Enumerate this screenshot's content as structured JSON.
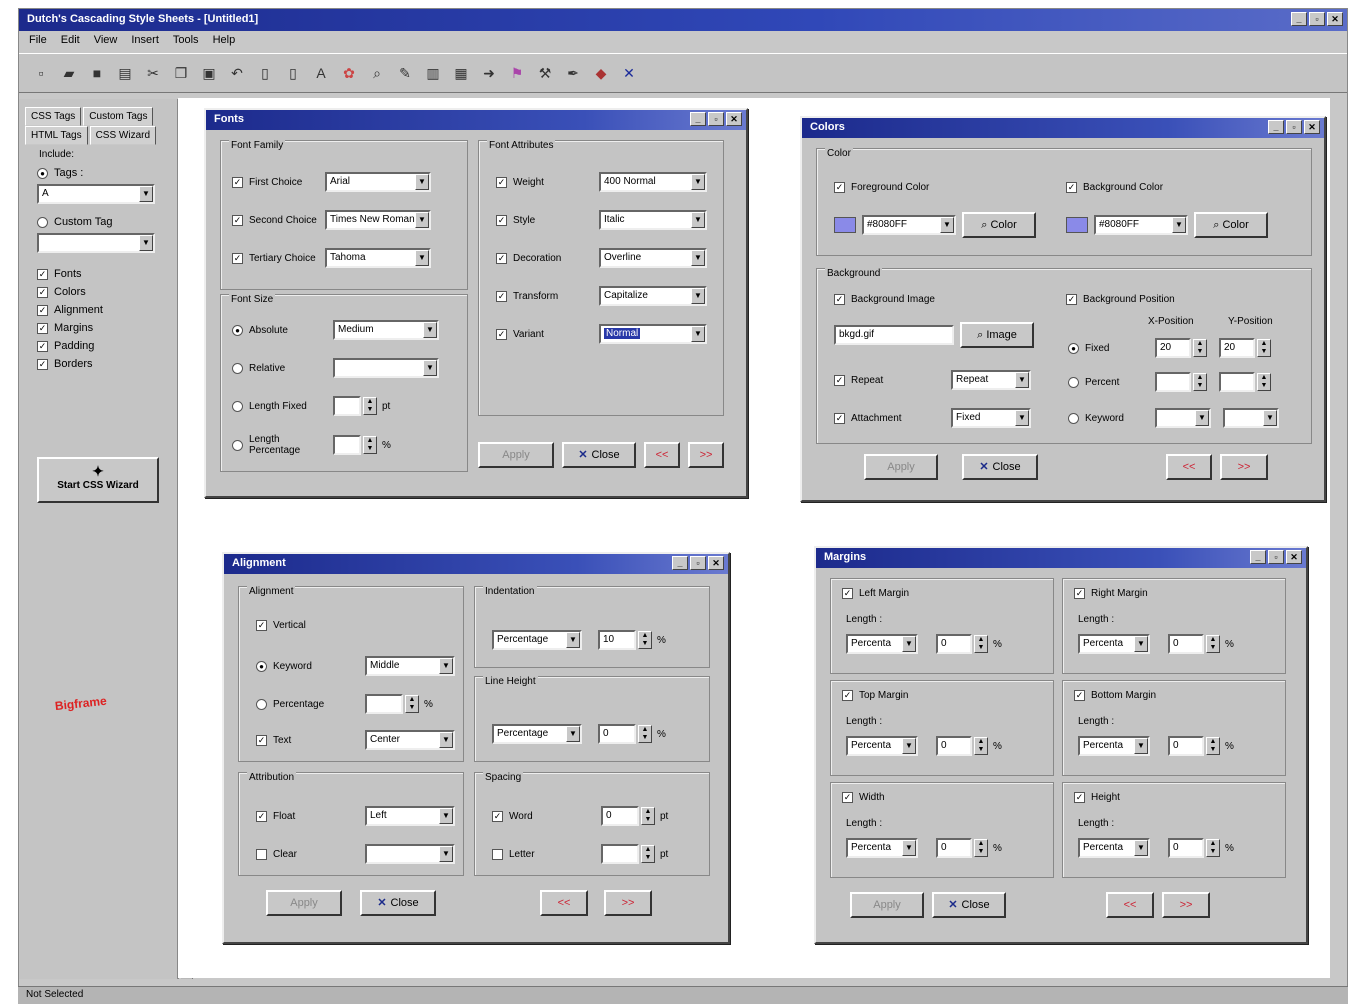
{
  "window": {
    "title": "Dutch's Cascading Style Sheets - [Untitled1]",
    "buttons": [
      "_",
      "▫",
      "✕"
    ]
  },
  "menu": [
    "File",
    "Edit",
    "View",
    "Insert",
    "Tools",
    "Help"
  ],
  "toolbar_icons": [
    "new-icon",
    "open-icon",
    "save-icon",
    "print-icon",
    "cut-icon",
    "copy-icon",
    "paste-icon",
    "undo-icon",
    "page-icon",
    "page2-icon",
    "font-icon",
    "color-icon",
    "search-icon",
    "brush-icon",
    "chart-icon",
    "grid-icon",
    "arrow-icon",
    "flag-icon",
    "tool-icon",
    "pen-icon",
    "bucket-icon",
    "delete-icon"
  ],
  "sidebar": {
    "tabs_row1": [
      "CSS Tags",
      "Custom Tags"
    ],
    "tabs_row2": [
      "HTML Tags",
      "CSS Wizard"
    ],
    "section": "Include:",
    "tags_label": "Tags :",
    "tags_value": "A",
    "custom_tag_label": "Custom Tag",
    "custom_tag_value": "",
    "options": [
      "Fonts",
      "Colors",
      "Alignment",
      "Margins",
      "Padding",
      "Borders"
    ],
    "wizard_button": "Start CSS Wizard",
    "stamp": "Bigframe"
  },
  "fonts_dialog": {
    "title": "Fonts",
    "font_family_label": "Font Family",
    "families": [
      {
        "label": "First Choice",
        "value": "Arial"
      },
      {
        "label": "Second Choice",
        "value": "Times New Roman"
      },
      {
        "label": "Tertiary Choice",
        "value": "Tahoma"
      }
    ],
    "font_attributes_label": "Font Attributes",
    "attributes": [
      {
        "label": "Weight",
        "value": "400 Normal"
      },
      {
        "label": "Style",
        "value": "Italic"
      },
      {
        "label": "Decoration",
        "value": "Overline"
      },
      {
        "label": "Transform",
        "value": "Capitalize"
      },
      {
        "label": "Variant",
        "value": "Normal"
      }
    ],
    "font_size_label": "Font Size",
    "sizes": [
      {
        "label": "Absolute",
        "value": "Medium",
        "unit": ""
      },
      {
        "label": "Relative",
        "value": "",
        "unit": ""
      },
      {
        "label": "Length Fixed",
        "value": "",
        "unit": "pt"
      },
      {
        "label": "Length Percentage",
        "value": "",
        "unit": "%"
      }
    ],
    "buttons": {
      "apply": "Apply",
      "close": "Close",
      "b3": "<<",
      "b4": ">>"
    }
  },
  "colors_dialog": {
    "title": "Colors",
    "color_label": "Color",
    "fg_label": "Foreground Color",
    "fg_value": "#8080FF",
    "bg_label": "Background Color",
    "bg_value": "#8080FF",
    "color_button": "Color",
    "background_label": "Background",
    "bg_image_label": "Background Image",
    "bg_image_value": "bkgd.gif",
    "image_button": "Image",
    "repeat_label": "Repeat",
    "repeat_value": "Repeat",
    "attachment_label": "Attachment",
    "attachment_value": "Fixed",
    "bg_position_label": "Background Position",
    "x_position_label": "X-Position",
    "y_position_label": "Y-Position",
    "position_rows": [
      {
        "label": "Fixed",
        "x": "20",
        "y": "20"
      },
      {
        "label": "Percent",
        "x": "",
        "y": ""
      },
      {
        "label": "Keyword",
        "x": "",
        "y": ""
      }
    ],
    "buttons": {
      "apply": "Apply",
      "close": "Close",
      "b3": "<<",
      "b4": ">>"
    }
  },
  "alignment_dialog": {
    "title": "Alignment",
    "alignment_label": "Alignment",
    "vertical_label": "Vertical",
    "keyword_label": "Keyword",
    "keyword_value": "Middle",
    "percentage_label": "Percentage",
    "percentage_unit": "%",
    "text_label": "Text",
    "text_value": "Center",
    "indentation_label": "Indentation",
    "indentation_type": "Percentage",
    "indentation_value": "10",
    "indentation_unit": "%",
    "line_height_label": "Line Height",
    "line_height_type": "Percentage",
    "line_height_value": "0",
    "line_height_unit": "%",
    "attribution_label": "Attribution",
    "float_label": "Float",
    "float_value": "Left",
    "clear_label": "Clear",
    "clear_value": "",
    "spacing_label": "Spacing",
    "word_label": "Word",
    "word_value": "0",
    "word_unit": "pt",
    "letter_label": "Letter",
    "letter_value": "",
    "letter_unit": "pt",
    "buttons": {
      "apply": "Apply",
      "close": "Close",
      "b3": "<<",
      "b4": ">>"
    }
  },
  "margins_dialog": {
    "title": "Margins",
    "length_label": "Length :",
    "groups": [
      {
        "label": "Left Margin",
        "type": "Percenta",
        "value": "0",
        "unit": "%"
      },
      {
        "label": "Right Margin",
        "type": "Percenta",
        "value": "0",
        "unit": "%"
      },
      {
        "label": "Top Margin",
        "type": "Percenta",
        "value": "0",
        "unit": "%"
      },
      {
        "label": "Bottom Margin",
        "type": "Percenta",
        "value": "0",
        "unit": "%"
      },
      {
        "label": "Width",
        "type": "Percenta",
        "value": "0",
        "unit": "%"
      },
      {
        "label": "Height",
        "type": "Percenta",
        "value": "0",
        "unit": "%"
      }
    ],
    "buttons": {
      "apply": "Apply",
      "close": "Close",
      "b3": "<<",
      "b4": ">>"
    }
  },
  "status": {
    "text": "Not Selected"
  }
}
